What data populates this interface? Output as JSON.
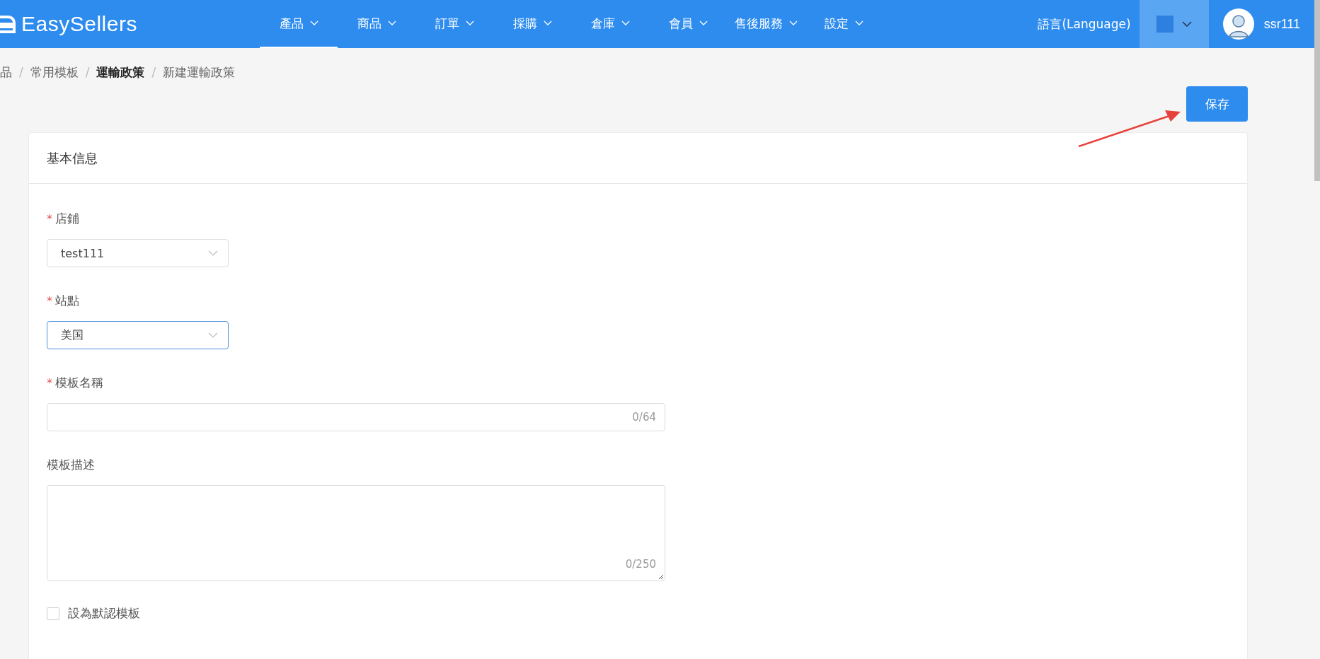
{
  "header": {
    "logo": "EasySellers",
    "nav": [
      {
        "label": "產品",
        "selected": true
      },
      {
        "label": "商品",
        "selected": false
      },
      {
        "label": "訂單",
        "selected": false
      },
      {
        "label": "採購",
        "selected": false
      },
      {
        "label": "倉庫",
        "selected": false
      },
      {
        "label": "會員",
        "selected": false
      },
      {
        "label": "售後服務",
        "selected": false
      },
      {
        "label": "設定",
        "selected": false
      }
    ],
    "language": "語言(Language)",
    "user": "ssr111"
  },
  "breadcrumb_separator": "/",
  "breadcrumb": [
    {
      "label": "品",
      "current": false
    },
    {
      "label": "常用模板",
      "current": false
    },
    {
      "label": "運輸政策",
      "current": true
    },
    {
      "label": "新建運輸政策",
      "current": false
    }
  ],
  "save_button": "保存",
  "card": {
    "title": "基本信息",
    "required_mark": "*",
    "fields": [
      {
        "kind": "select",
        "label": "店鋪",
        "required": true,
        "value": "test111",
        "focused": false
      },
      {
        "kind": "select",
        "label": "站點",
        "required": true,
        "value": "美国",
        "focused": true
      },
      {
        "kind": "input",
        "label": "模板名稱",
        "required": true,
        "counter": "0/64"
      },
      {
        "kind": "textarea",
        "label": "模板描述",
        "required": false,
        "counter": "0/250"
      },
      {
        "kind": "checkbox",
        "label": "設為默認模板",
        "checked": false
      }
    ]
  }
}
